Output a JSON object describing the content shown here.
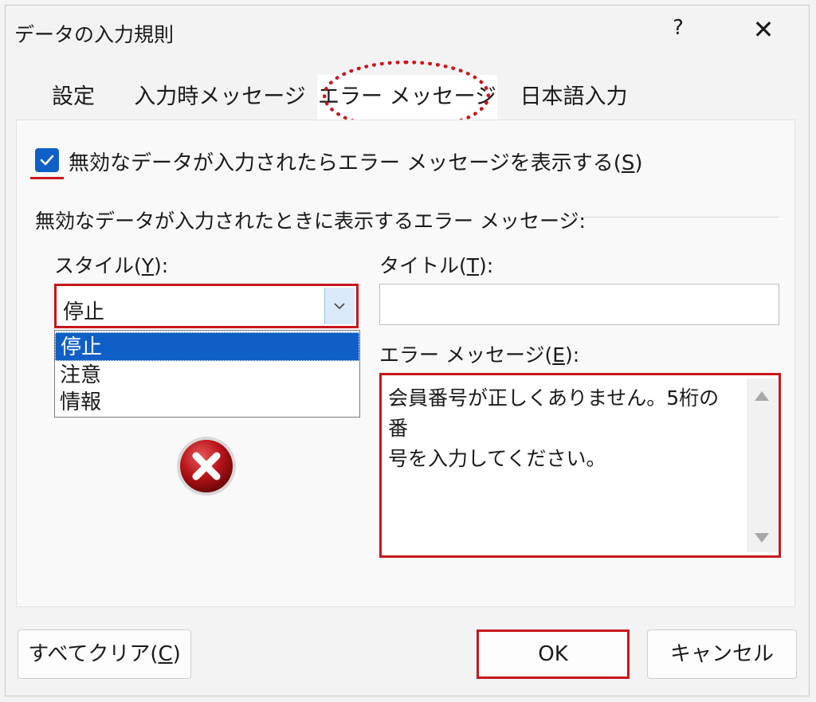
{
  "window": {
    "title": "データの入力規則",
    "help_label": "?",
    "close_label": "✕"
  },
  "tabs": [
    {
      "label": "設定"
    },
    {
      "label": "入力時メッセージ"
    },
    {
      "label": "エラー メッセージ",
      "selected": true
    },
    {
      "label": "日本語入力"
    }
  ],
  "checkbox": {
    "checked": true,
    "label_pre": "無効なデータが入力されたらエラー メッセージを表示する(",
    "mnemonic": "S",
    "label_post": ")"
  },
  "group_label": "無効なデータが入力されたときに表示するエラー メッセージ:",
  "style_field": {
    "label_pre": "スタイル(",
    "mnemonic": "Y",
    "label_post": "):",
    "value": "停止",
    "options": [
      "停止",
      "注意",
      "情報"
    ]
  },
  "title_field": {
    "label_pre": "タイトル(",
    "mnemonic": "T",
    "label_post": "):",
    "value": ""
  },
  "message_field": {
    "label_pre": "エラー メッセージ(",
    "mnemonic": "E",
    "label_post": "):",
    "line1": "会員番号が正しくありません。5桁の番",
    "line2": "号を入力してください。"
  },
  "buttons": {
    "clear_pre": "すべてクリア(",
    "clear_mnemonic": "C",
    "clear_post": ")",
    "ok": "OK",
    "cancel": "キャンセル"
  },
  "colors": {
    "accent": "#0f5fc6",
    "highlight": "#c8161d"
  }
}
